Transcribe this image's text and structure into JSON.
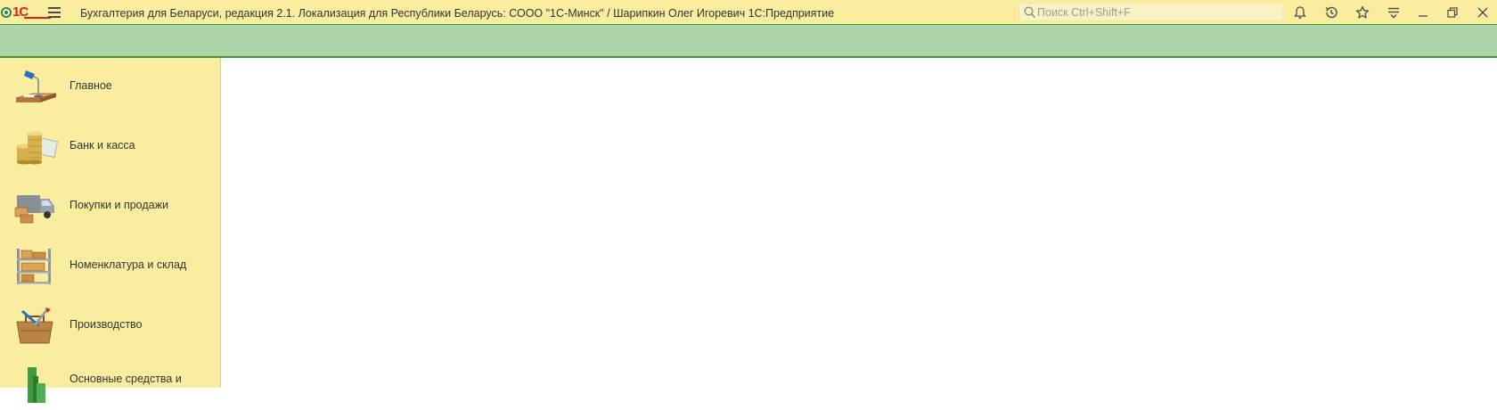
{
  "window": {
    "title": "Бухгалтерия для Беларуси, редакция 2.1. Локализация для Республики Беларусь: СООО \"1С-Минск\" / Шарипкин Олег Игоревич 1С:Предприятие",
    "logo_text": "1С"
  },
  "search": {
    "placeholder": "Поиск Ctrl+Shift+F"
  },
  "toolbar_icons": [
    "bell-icon",
    "history-icon",
    "star-icon",
    "sections-menu-icon",
    "minimize-icon",
    "restore-icon",
    "close-icon"
  ],
  "sidebar": {
    "items": [
      {
        "label": "Главное",
        "icon": "desk-lamp-icon"
      },
      {
        "label": "Банк и касса",
        "icon": "coins-icon"
      },
      {
        "label": "Покупки и продажи",
        "icon": "truck-icon"
      },
      {
        "label": "Номенклатура и склад",
        "icon": "shelf-icon"
      },
      {
        "label": "Производство",
        "icon": "toolbox-icon"
      },
      {
        "label": "Основные средства и",
        "icon": "fixed-assets-icon"
      }
    ]
  },
  "colors": {
    "titlebar_bg": "#fbeda0",
    "green_bar": "#acd5aa",
    "accent_green": "#3a9c3a",
    "logo_red": "#d62416",
    "sidebar_bg": "#fbeda0"
  }
}
